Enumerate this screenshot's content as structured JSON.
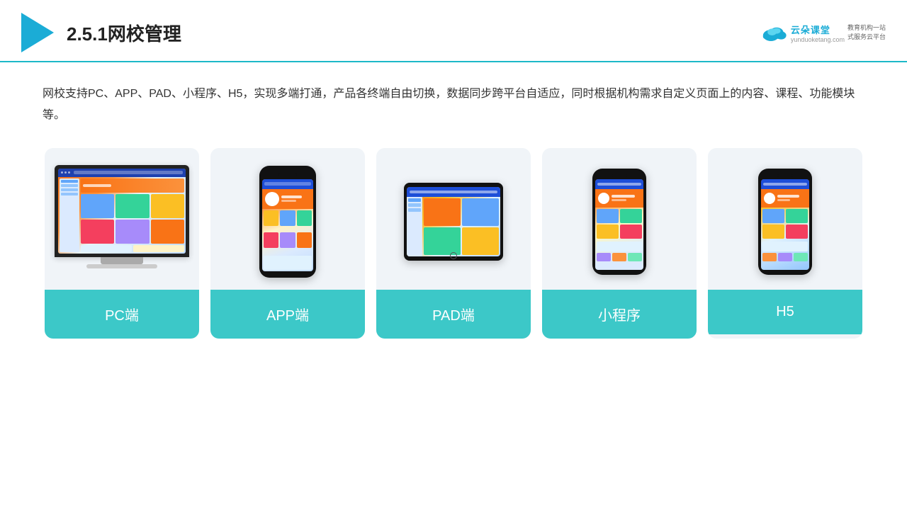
{
  "header": {
    "title": "2.5.1网校管理",
    "brand": {
      "name": "云朵课堂",
      "domain": "yunduoketang.com",
      "slogan_line1": "教育机构一站",
      "slogan_line2": "式服务云平台"
    }
  },
  "description": "网校支持PC、APP、PAD、小程序、H5，实现多端打通，产品各终端自由切换，数据同步跨平台自适应，同时根据机构需求自定义页面上的内容、课程、功能模块等。",
  "cards": [
    {
      "id": "pc",
      "label": "PC端"
    },
    {
      "id": "app",
      "label": "APP端"
    },
    {
      "id": "pad",
      "label": "PAD端"
    },
    {
      "id": "miniprogram",
      "label": "小程序"
    },
    {
      "id": "h5",
      "label": "H5"
    }
  ],
  "colors": {
    "accent": "#3cc8c8",
    "header_line": "#1db8c8",
    "logo_triangle": "#1bacd6"
  }
}
